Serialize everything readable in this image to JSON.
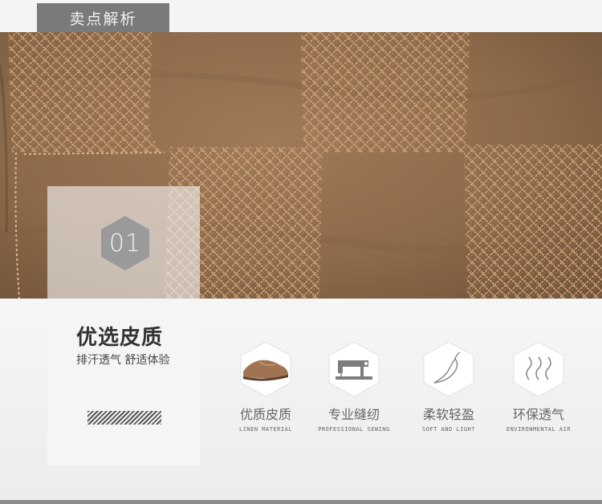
{
  "section_tab": {
    "label": "卖点解析"
  },
  "panel": {
    "number": "01",
    "title": "优选皮质",
    "subtitle": "排汗透气 舒适体验"
  },
  "features": [
    {
      "label": "优质皮质",
      "en": "LINEN MATERIAL",
      "icon": "loafer-shoe-icon"
    },
    {
      "label": "专业缝纫",
      "en": "PROFESSIONAL SEWING",
      "icon": "sewing-machine-icon"
    },
    {
      "label": "柔软轻盈",
      "en": "SOFT AND LIGHT",
      "icon": "chili-pepper-icon"
    },
    {
      "label": "环保透气",
      "en": "ENVIRONMENTAL AIR",
      "icon": "airflow-waves-icon"
    }
  ],
  "colors": {
    "leather": "#8d6a4a",
    "stitch": "#d8aa7e",
    "tab_bg": "#7a7a7a",
    "text_dark": "#333333"
  }
}
